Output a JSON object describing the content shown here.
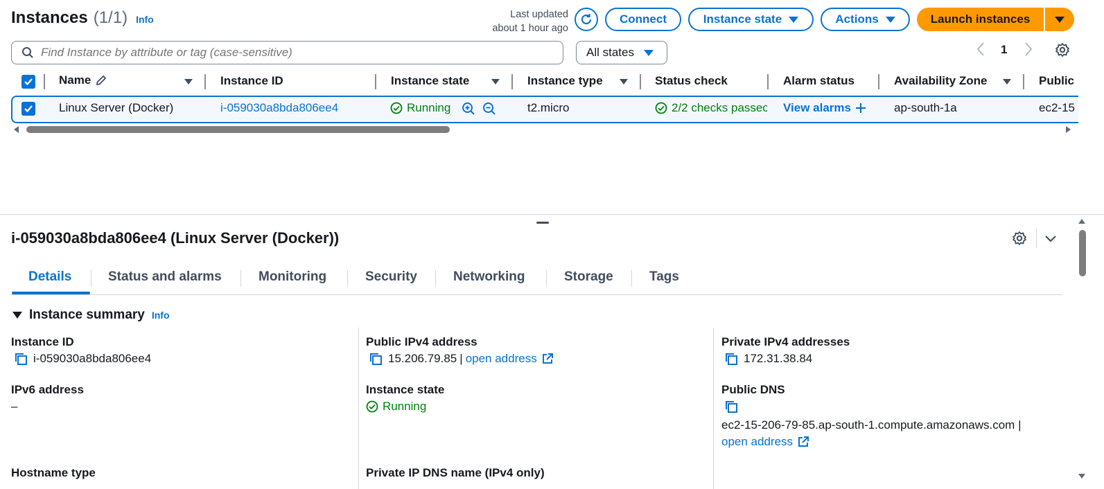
{
  "header": {
    "title": "Instances",
    "count": "(1/1)",
    "info": "Info",
    "last_updated_line1": "Last updated",
    "last_updated_line2": "about 1 hour ago",
    "connect": "Connect",
    "instance_state": "Instance state",
    "actions": "Actions",
    "launch": "Launch instances"
  },
  "search": {
    "placeholder": "Find Instance by attribute or tag (case-sensitive)",
    "state_filter": "All states",
    "page": "1"
  },
  "table": {
    "columns": [
      "Name",
      "Instance ID",
      "Instance state",
      "Instance type",
      "Status check",
      "Alarm status",
      "Availability Zone",
      "Public"
    ],
    "row": {
      "name": "Linux Server (Docker)",
      "instance_id": "i-059030a8bda806ee4",
      "state": "Running",
      "type": "t2.micro",
      "status_check": "2/2 checks passec",
      "alarm": "View alarms",
      "az": "ap-south-1a",
      "public": "ec2-15"
    }
  },
  "detail": {
    "title": "i-059030a8bda806ee4 (Linux Server (Docker))",
    "tabs": [
      "Details",
      "Status and alarms",
      "Monitoring",
      "Security",
      "Networking",
      "Storage",
      "Tags"
    ],
    "active_tab": "Details",
    "section": "Instance summary",
    "section_info": "Info",
    "instance_id_label": "Instance ID",
    "instance_id_value": "i-059030a8bda806ee4",
    "ipv6_label": "IPv6 address",
    "ipv6_value": "–",
    "hostname_label": "Hostname type",
    "public_ipv4_label": "Public IPv4 address",
    "public_ipv4_value": "15.206.79.85",
    "separator": "|",
    "open_address": "open address",
    "instance_state_label": "Instance state",
    "instance_state_value": "Running",
    "private_dns_label": "Private IP DNS name (IPv4 only)",
    "private_ipv4_label": "Private IPv4 addresses",
    "private_ipv4_value": "172.31.38.84",
    "public_dns_label": "Public DNS",
    "public_dns_value": "ec2-15-206-79-85.ap-south-1.compute.amazonaws.com |",
    "public_dns_open": "open address"
  },
  "colors": {
    "primary": "#0972d3",
    "launch": "#ff9900",
    "success": "#037f0c",
    "selected_row_bg": "#f2f8fd"
  }
}
